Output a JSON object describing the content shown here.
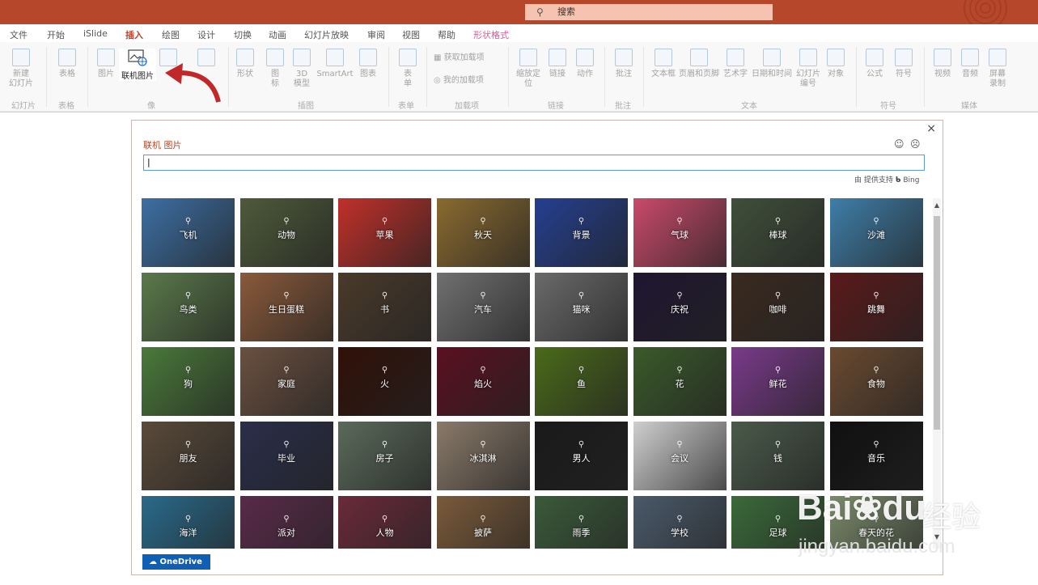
{
  "titlebar": {
    "search_label": "搜索"
  },
  "tabs": [
    "文件",
    "开始",
    "iSlide",
    "插入",
    "绘图",
    "设计",
    "切换",
    "动画",
    "幻灯片放映",
    "审阅",
    "视图",
    "帮助",
    "形状格式"
  ],
  "ribbon": {
    "new_slide": "新建\n幻灯片",
    "table": "表格",
    "picture": "图片",
    "online_picture": "联机图片",
    "shapes": "形状",
    "icons": "图\n标",
    "3d": "3D\n模型",
    "smartart": "SmartArt",
    "chart": "图表",
    "form": "表\n单",
    "get_addins": "获取加载项",
    "my_addins": "我的加载项",
    "zoom": "缩放定\n位",
    "link": "链接",
    "action": "动作",
    "comment": "批注",
    "textbox": "文本框",
    "header_footer": "页眉和页脚",
    "wordart": "艺术字",
    "datetime": "日期和时间",
    "slide_number": "幻灯片\n编号",
    "object": "对象",
    "equation": "公式",
    "symbol": "符号",
    "video": "视频",
    "audio": "音频",
    "screen_record": "屏幕\n录制",
    "groups": [
      "幻灯片",
      "表格",
      "像",
      "插图",
      "表单",
      "加载项",
      "链接",
      "批注",
      "文本",
      "符号",
      "媒体"
    ]
  },
  "dialog": {
    "title": "联机 图片",
    "search_value": "",
    "powered_by": "由 提供支持",
    "bing": "Bing",
    "onedrive": "OneDrive",
    "tiles": [
      "飞机",
      "动物",
      "苹果",
      "秋天",
      "背景",
      "气球",
      "棒球",
      "沙滩",
      "鸟类",
      "生日蛋糕",
      "书",
      "汽车",
      "猫咪",
      "庆祝",
      "咖啡",
      "跳舞",
      "狗",
      "家庭",
      "火",
      "焰火",
      "鱼",
      "花",
      "鲜花",
      "食物",
      "朋友",
      "毕业",
      "房子",
      "冰淇淋",
      "男人",
      "会议",
      "钱",
      "音乐",
      "海洋",
      "派对",
      "人物",
      "披萨",
      "雨季",
      "学校",
      "足球",
      "春天的花"
    ]
  },
  "watermark": {
    "brand": "Bai",
    "brand2": "du",
    "site": "经验",
    "url": "jingyan.baidu.com"
  }
}
